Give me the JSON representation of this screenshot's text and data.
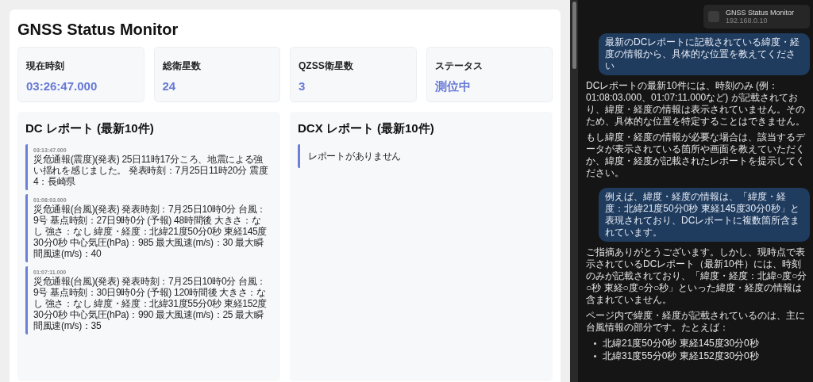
{
  "app": {
    "title": "GNSS Status Monitor",
    "stats": [
      {
        "label": "現在時刻",
        "value": "03:26:47.000"
      },
      {
        "label": "総衛星数",
        "value": "24"
      },
      {
        "label": "QZSS衛星数",
        "value": "3"
      },
      {
        "label": "ステータス",
        "value": "測位中"
      }
    ],
    "panels": [
      {
        "title": "DC レポート (最新10件)",
        "reports": [
          {
            "time": "03:13:47.000",
            "text": "災危通報(震度)(発表) 25日11時17分ころ、地震による強い揺れを感じました。 発表時刻：7月25日11時20分 震度4：長崎県"
          },
          {
            "time": "01:08:03.000",
            "text": "災危通報(台風)(発表) 発表時刻：7月25日10時0分 台風：9号 基点時刻：27日9時0分 (予報) 48時間後 大きさ：なし 強さ：なし 緯度・経度：北緯21度50分0秒 東経145度30分0秒 中心気圧(hPa)：985 最大風速(m/s)：30 最大瞬間風速(m/s)：40"
          },
          {
            "time": "01:07:11.000",
            "text": "災危通報(台風)(発表) 発表時刻：7月25日10時0分 台風：9号 基点時刻：30日9時0分 (予報) 120時間後 大きさ：なし 強さ：なし 緯度・経度：北緯31度55分0秒 東経152度30分0秒 中心気圧(hPa)：990 最大風速(m/s)：25 最大瞬間風速(m/s)：35"
          }
        ]
      },
      {
        "title": "DCX レポート (最新10件)",
        "empty_text": "レポートがありません"
      }
    ]
  },
  "chat": {
    "source": {
      "title": "GNSS Status Monitor",
      "address": "192.168.0.10"
    },
    "messages": [
      {
        "kind": "user",
        "paragraphs": [
          "最新のDCレポートに記載されている緯度・経度の情報から、具体的な位置を教えてください"
        ]
      },
      {
        "kind": "assistant",
        "paragraphs": [
          "DCレポートの最新10件には、時刻のみ (例：01:08:03.000、01:07:11.000など) が記載されており、緯度・経度の情報は表示されていません。そのため、具体的な位置を特定することはできません。",
          "もし緯度・経度の情報が必要な場合は、該当するデータが表示されている箇所や画面を教えていただくか、緯度・経度が記載されたレポートを提示してください。"
        ]
      },
      {
        "kind": "user",
        "paragraphs": [
          "例えば、緯度・経度の情報は、「緯度・経度：北緯21度50分0秒 東経145度30分0秒」と表現されており、DCレポートに複数箇所含まれています。"
        ]
      },
      {
        "kind": "assistant",
        "paragraphs": [
          "ご指摘ありがとうございます。しかし、現時点で表示されているDCレポート（最新10件）には、時刻のみが記載されており、「緯度・経度：北緯○度○分○秒 東経○度○分○秒」といった緯度・経度の情報は含まれていません。",
          "ページ内で緯度・経度が記載されているのは、主に台風情報の部分です。たとえば："
        ],
        "bullets": [
          "北緯21度50分0秒 東経145度30分0秒",
          "北緯31度55分0秒 東経152度30分0秒"
        ]
      }
    ]
  }
}
